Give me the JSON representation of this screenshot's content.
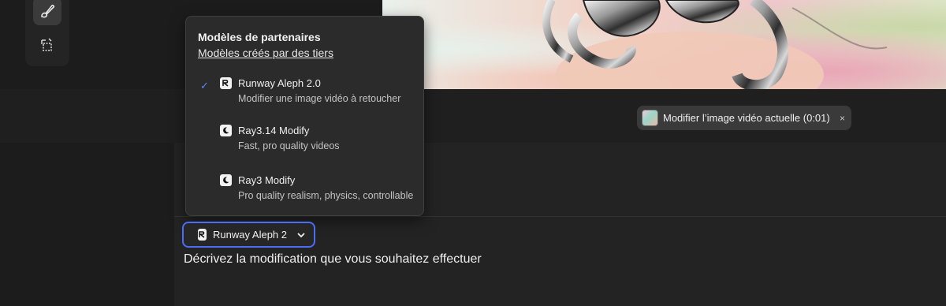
{
  "dropdown": {
    "title": "Modèles de partenaires",
    "link": "Modèles créés par des tiers",
    "options": [
      {
        "name": "Runway Aleph 2.0",
        "description": "Modifier une image vidéo à retoucher",
        "selected": true,
        "icon": "runway-logo-icon"
      },
      {
        "name": "Ray3.14 Modify",
        "description": "Fast, pro quality videos",
        "selected": false,
        "icon": "luma-logo-icon"
      },
      {
        "name": "Ray3 Modify",
        "description": "Pro quality realism, physics, controllable",
        "selected": false,
        "icon": "luma-logo-icon"
      }
    ],
    "check_glyph": "✓"
  },
  "context_chip": {
    "label": "Modifier l’image vidéo actuelle (0:01)",
    "close": "×"
  },
  "model_select": {
    "label": "Runway Aleph 2"
  },
  "prompt": {
    "placeholder": "Décrivez la modification que vous souhaitez effectuer"
  },
  "colors": {
    "accent": "#4a6cf7",
    "check": "#5b86ff"
  }
}
